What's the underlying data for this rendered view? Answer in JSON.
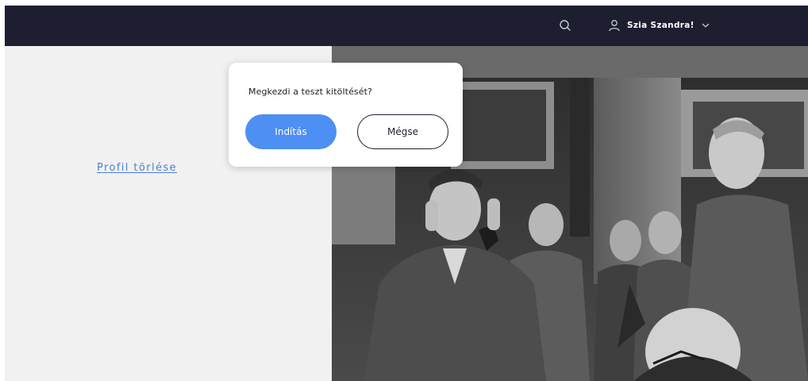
{
  "header": {
    "search_icon": "search-icon",
    "user_icon": "user-icon",
    "greeting": "Szia Szandra!",
    "chevron_icon": "chevron-down-icon"
  },
  "left_panel": {
    "profile_delete_link": "Profil törlése",
    "link_color": "#4a7fd1"
  },
  "modal": {
    "question": "Megkezdi a teszt kitöltését?",
    "start_button": "Indítás",
    "cancel_button": "Mégse",
    "start_color": "#4d8ff2"
  },
  "colors": {
    "topbar": "#1d1f31",
    "panel_bg": "#f1f1f1"
  }
}
